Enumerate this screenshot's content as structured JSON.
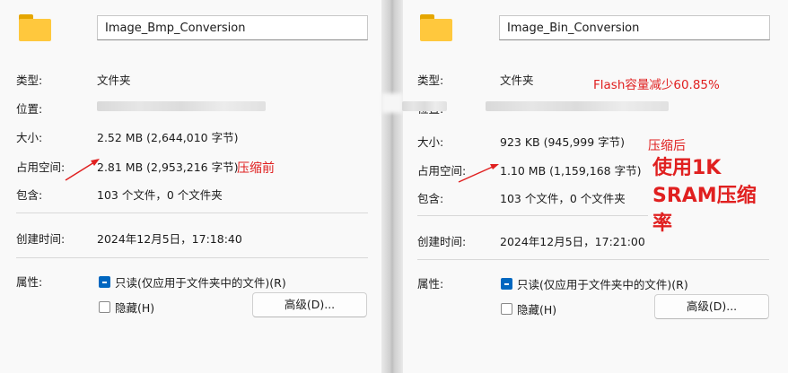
{
  "left": {
    "name": "Image_Bmp_Conversion",
    "rows": {
      "type": {
        "label": "类型:",
        "value": "文件夹"
      },
      "location": {
        "label": "位置:"
      },
      "size": {
        "label": "大小:",
        "value": "2.52 MB (2,644,010 字节)"
      },
      "size_on_disk": {
        "label": "占用空间:",
        "value": "2.81 MB (2,953,216 字节)"
      },
      "contains": {
        "label": "包含:",
        "value": "103 个文件，0 个文件夹"
      },
      "created": {
        "label": "创建时间:",
        "value": "2024年12月5日，17:18:40"
      }
    },
    "attributes_label": "属性:",
    "readonly_label": "只读(仅应用于文件夹中的文件)(R)",
    "hidden_label": "隐藏(H)",
    "advanced_button": "高级(D)...",
    "annotation": "压缩前"
  },
  "right": {
    "name": "Image_Bin_Conversion",
    "rows": {
      "type": {
        "label": "类型:",
        "value": "文件夹"
      },
      "location": {
        "label": "位置:"
      },
      "size": {
        "label": "大小:",
        "value": "923 KB (945,999 字节)"
      },
      "size_on_disk": {
        "label": "占用空间:",
        "value": "1.10 MB (1,159,168 字节)"
      },
      "contains": {
        "label": "包含:",
        "value": "103 个文件，0 个文件夹"
      },
      "created": {
        "label": "创建时间:",
        "value": "2024年12月5日，17:21:00"
      }
    },
    "attributes_label": "属性:",
    "readonly_label": "只读(仅应用于文件夹中的文件)(R)",
    "hidden_label": "隐藏(H)",
    "advanced_button": "高级(D)...",
    "annotation_flash": "Flash容量减少60.85%",
    "annotation_after": "压缩后",
    "annotation_sram_1": "使用1K",
    "annotation_sram_2": "SRAM压缩",
    "annotation_sram_3": "率"
  },
  "colors": {
    "annotation": "#e02020",
    "checkbox": "#0067c0",
    "folder": "#ffc83d"
  }
}
